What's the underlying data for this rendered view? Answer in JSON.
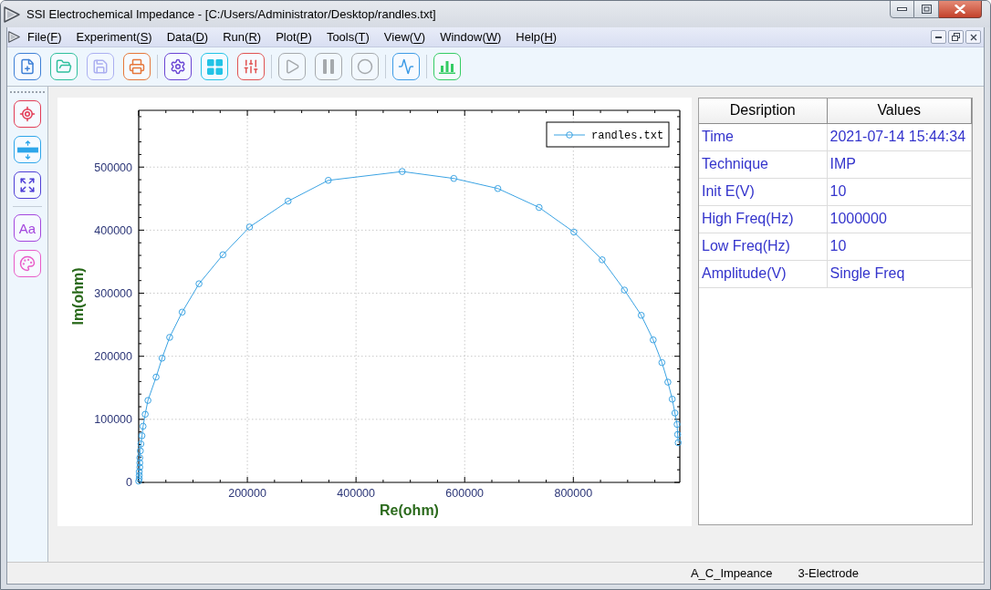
{
  "window": {
    "title": "SSI Electrochemical Impedance - [C:/Users/Administrator/Desktop/randles.txt]"
  },
  "menu": [
    {
      "label": [
        "File(",
        "F",
        ")"
      ]
    },
    {
      "label": [
        "Experiment(",
        "S",
        ")"
      ]
    },
    {
      "label": [
        "Data(",
        "D",
        ")"
      ]
    },
    {
      "label": [
        "Run(",
        "R",
        ")"
      ]
    },
    {
      "label": [
        "Plot(",
        "P",
        ")"
      ]
    },
    {
      "label": [
        "Tools(",
        "T",
        ")"
      ]
    },
    {
      "label": [
        "View(",
        "V",
        ")"
      ]
    },
    {
      "label": [
        "Window(",
        "W",
        ")"
      ]
    },
    {
      "label": [
        "Help(",
        "H",
        ")"
      ]
    }
  ],
  "toolbar": [
    [
      {
        "kind": "new",
        "disabled": false
      },
      {
        "kind": "open",
        "disabled": false
      },
      {
        "kind": "save",
        "disabled": true
      },
      {
        "kind": "print",
        "disabled": false
      }
    ],
    [
      {
        "kind": "settings",
        "disabled": false
      },
      {
        "kind": "grid",
        "disabled": false
      },
      {
        "kind": "sliders",
        "disabled": false
      }
    ],
    [
      {
        "kind": "play",
        "disabled": true
      },
      {
        "kind": "pause",
        "disabled": true
      },
      {
        "kind": "stop",
        "disabled": true
      }
    ],
    [
      {
        "kind": "signal",
        "disabled": false
      }
    ],
    [
      {
        "kind": "chart",
        "disabled": false
      }
    ]
  ],
  "side_toolbar": [
    [
      {
        "kind": "crosshair"
      },
      {
        "kind": "height"
      },
      {
        "kind": "fit"
      }
    ],
    [
      {
        "kind": "font",
        "text": "Aa"
      },
      {
        "kind": "palette"
      }
    ]
  ],
  "plot": {
    "chart_data": {
      "type": "line",
      "xlabel": "Re(ohm)",
      "ylabel": "Im(ohm)",
      "x": [
        0,
        1000,
        1000,
        1000,
        2000,
        2000,
        2000,
        3000,
        4000,
        6000,
        8000,
        12000,
        17000,
        32000,
        43000,
        57000,
        80000,
        111000,
        155000,
        204000,
        275000,
        349000,
        485000,
        580000,
        661000,
        737000,
        801000,
        853000,
        894000,
        925000,
        947000,
        963000,
        974000,
        982000,
        987000,
        991000,
        992000,
        993000
      ],
      "series": [
        {
          "name": "randles.txt",
          "color": "#3ba3e3",
          "marker": "circle",
          "values": [
            2000,
            6000,
            11000,
            17000,
            24000,
            31000,
            39000,
            50000,
            61000,
            74000,
            89000,
            108000,
            130000,
            167000,
            197000,
            230000,
            270000,
            315000,
            361000,
            405000,
            446000,
            479000,
            493000,
            482000,
            466000,
            436000,
            397000,
            353000,
            305000,
            265000,
            226000,
            190000,
            159000,
            132000,
            110000,
            92000,
            76000,
            63000
          ]
        }
      ],
      "xlim": [
        0,
        996000
      ],
      "ylim": [
        0,
        590000
      ],
      "xticks": [
        200000,
        400000,
        600000,
        800000
      ],
      "yticks": [
        0,
        100000,
        200000,
        300000,
        400000,
        500000
      ],
      "grid": true
    }
  },
  "table": {
    "columns": [
      "Desription",
      "Values"
    ],
    "rows": [
      [
        "Time",
        "2021-07-14 15:44:34"
      ],
      [
        "Technique",
        "IMP"
      ],
      [
        "Init E(V)",
        "10"
      ],
      [
        "High Freq(Hz)",
        "1000000"
      ],
      [
        "Low Freq(Hz)",
        "10"
      ],
      [
        "Amplitude(V)",
        "Single Freq"
      ]
    ]
  },
  "status_bar": [
    "A_C_Impeance",
    "3-Electrode"
  ]
}
